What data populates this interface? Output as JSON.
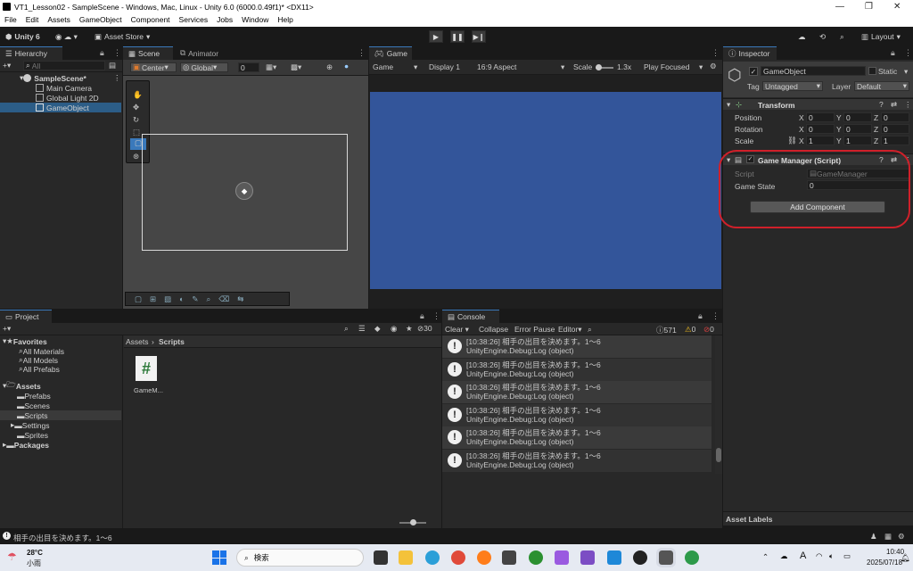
{
  "window": {
    "title": "VT1_Lesson02 - SampleScene - Windows, Mac, Linux - Unity 6.0 (6000.0.49f1)* <DX11>"
  },
  "menu": [
    "File",
    "Edit",
    "Assets",
    "GameObject",
    "Component",
    "Services",
    "Jobs",
    "Window",
    "Help"
  ],
  "toolbar": {
    "account": "Unity 6",
    "asset_store": "Asset Store",
    "layout": "Layout"
  },
  "hierarchy": {
    "tab": "Hierarchy",
    "search_placeholder": "All",
    "scene": "SampleScene*",
    "items": [
      "Main Camera",
      "Global Light 2D",
      "GameObject"
    ]
  },
  "scene": {
    "tab": "Scene",
    "tab2": "Animator",
    "pivot": "Center",
    "space": "Global",
    "snap_value": "0"
  },
  "game": {
    "tab": "Game",
    "mode": "Game",
    "display": "Display 1",
    "aspect": "16:9 Aspect",
    "scale_label": "Scale",
    "scale_value": "1.3x",
    "play_mode": "Play Focused",
    "bg_color": "#33559a"
  },
  "inspector": {
    "tab": "Inspector",
    "object_name": "GameObject",
    "static_label": "Static",
    "tag_label": "Tag",
    "tag_value": "Untagged",
    "layer_label": "Layer",
    "layer_value": "Default",
    "transform": {
      "title": "Transform",
      "rows": [
        {
          "label": "Position",
          "x": "0",
          "y": "0",
          "z": "0"
        },
        {
          "label": "Rotation",
          "x": "0",
          "y": "0",
          "z": "0"
        },
        {
          "label": "Scale",
          "x": "1",
          "y": "1",
          "z": "1"
        }
      ]
    },
    "script_component": {
      "title": "Game Manager (Script)",
      "script_label": "Script",
      "script_value": "GameManager",
      "state_label": "Game State",
      "state_value": "0"
    },
    "add_component": "Add Component",
    "asset_labels": "Asset Labels",
    "highlight_color": "#d0202a"
  },
  "project": {
    "tab": "Project",
    "breadcrumb_root": "Assets",
    "breadcrumb_leaf": "Scripts",
    "hidden_count": "30",
    "favorites": {
      "label": "Favorites",
      "items": [
        "All Materials",
        "All Models",
        "All Prefabs"
      ]
    },
    "assets": {
      "label": "Assets",
      "items": [
        "Prefabs",
        "Scenes",
        "Scripts",
        "Settings",
        "Sprites"
      ]
    },
    "packages": "Packages",
    "file": "GameM..."
  },
  "console": {
    "tab": "Console",
    "clear": "Clear",
    "collapse": "Collapse",
    "error_pause": "Error Pause",
    "editor": "Editor",
    "log_count": "571",
    "warn_count": "0",
    "error_count": "0",
    "entries": [
      {
        "line1": "[10:38:26] 相手の出目を決めます。1～6",
        "line2": "UnityEngine.Debug:Log (object)"
      },
      {
        "line1": "[10:38:26] 相手の出目を決めます。1～6",
        "line2": "UnityEngine.Debug:Log (object)"
      },
      {
        "line1": "[10:38:26] 相手の出目を決めます。1～6",
        "line2": "UnityEngine.Debug:Log (object)"
      },
      {
        "line1": "[10:38:26] 相手の出目を決めます。1～6",
        "line2": "UnityEngine.Debug:Log (object)"
      },
      {
        "line1": "[10:38:26] 相手の出目を決めます。1～6",
        "line2": "UnityEngine.Debug:Log (object)"
      },
      {
        "line1": "[10:38:26] 相手の出目を決めます。1～6",
        "line2": "UnityEngine.Debug:Log (object)"
      }
    ]
  },
  "status": {
    "message": "相手の出目を決めます。1～6"
  },
  "taskbar": {
    "temp": "28°C",
    "weather": "小雨",
    "search": "検索",
    "time": "10:40",
    "date": "2025/07/18",
    "ime": "A"
  }
}
